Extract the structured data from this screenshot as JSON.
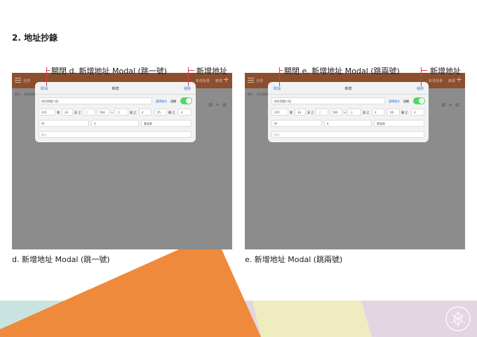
{
  "section_title": "2. 地址抄錄",
  "panels": {
    "d": {
      "callout_close": "關閉 d. 新增地址 Modal (跳一號)",
      "callout_add": "新增地址",
      "caption": "d. 新增地址 Modal (跳一號)",
      "app_bar": {
        "left": "全部",
        "right1": "新增批量",
        "right2": "篩選",
        "plus": "+"
      },
      "sub_row": {
        "left": "總計：",
        "mid": "研究院路二段"
      },
      "modal": {
        "cancel": "取消",
        "title": "新增",
        "save": "儲存",
        "street": "研究院路二段",
        "pick_street": "選擇路名",
        "continuous": "連續",
        "row2": [
          "245",
          "巷",
          "34",
          "弄 之",
          "之",
          "568",
          "~",
          "號",
          "號 之",
          "4",
          "05",
          "樓 之",
          "4"
        ],
        "row3": [
          "W",
          "4",
          "靠道東"
        ],
        "note": "備註"
      }
    },
    "e": {
      "callout_close": "關閉 e. 新增地址 Modal (跳兩號)",
      "callout_add": "新增地址",
      "caption": "e. 新增地址 Modal (跳兩號)",
      "app_bar": {
        "left": "全部",
        "right1": "新增批量",
        "right2": "篩選",
        "plus": "+"
      },
      "sub_row": {
        "left": "總計：",
        "mid": "研究院路二段"
      },
      "modal": {
        "cancel": "取消",
        "title": "新增",
        "save": "儲存",
        "street": "研究院路二段",
        "pick_street": "選擇路名",
        "continuous": "連續",
        "row2": [
          "245",
          "巷",
          "34",
          "弄 之",
          "之",
          "569",
          "~",
          "號",
          "號 之",
          "4",
          "06",
          "樓 之",
          "4"
        ],
        "row3": [
          "W",
          "4",
          "靠道東"
        ],
        "note": "備註"
      }
    }
  },
  "colors": {
    "app_bar": "#8d4e2e",
    "overlay": "#8c8c8c",
    "link": "#2a7be4",
    "toggle": "#4cd964",
    "callout_mark": "#d73a4a",
    "orange": "#ef8a3c",
    "teal": "#c9e4e0",
    "lavender": "#e3d6e2",
    "cream": "#efedc0"
  },
  "icons": [
    "menu-icon",
    "plus-icon",
    "toggle-switch",
    "logo-emblem"
  ]
}
